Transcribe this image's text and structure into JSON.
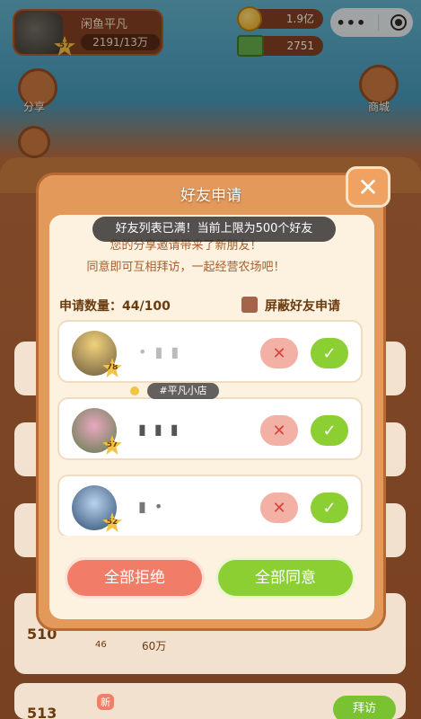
{
  "player": {
    "name": "闲鱼平凡",
    "level": "57",
    "exp": "2191/13万"
  },
  "currency": {
    "coins": "1.9亿",
    "cash": "2751"
  },
  "side": {
    "share": "分享",
    "shop": "商城"
  },
  "modal": {
    "title": "好友申请",
    "toast": "好友列表已满！当前上限为500个好友",
    "desc1": "您的分享邀请带来了新朋友！",
    "desc2": "同意即可互相拜访，一起经营农场吧！",
    "request_count": "申请数量：44/100",
    "block_label": "屏蔽好友申请",
    "shop_tag": "#平凡小店",
    "requests": [
      {
        "name": "• ▮ ▮",
        "level": "78",
        "reject": "✕",
        "accept": "✓"
      },
      {
        "name": "▮ ▮ ▮",
        "level": "57",
        "reject": "✕",
        "accept": "✓"
      },
      {
        "name": "▮ •",
        "level": "52",
        "reject": "✕",
        "accept": "✓"
      }
    ],
    "reject_all": "全部拒绝",
    "accept_all": "全部同意"
  },
  "background_list": [
    {
      "rank": "510",
      "level": "46",
      "gold": "60万"
    },
    {
      "rank": "513",
      "badge": "新",
      "visit": "拜访"
    }
  ]
}
